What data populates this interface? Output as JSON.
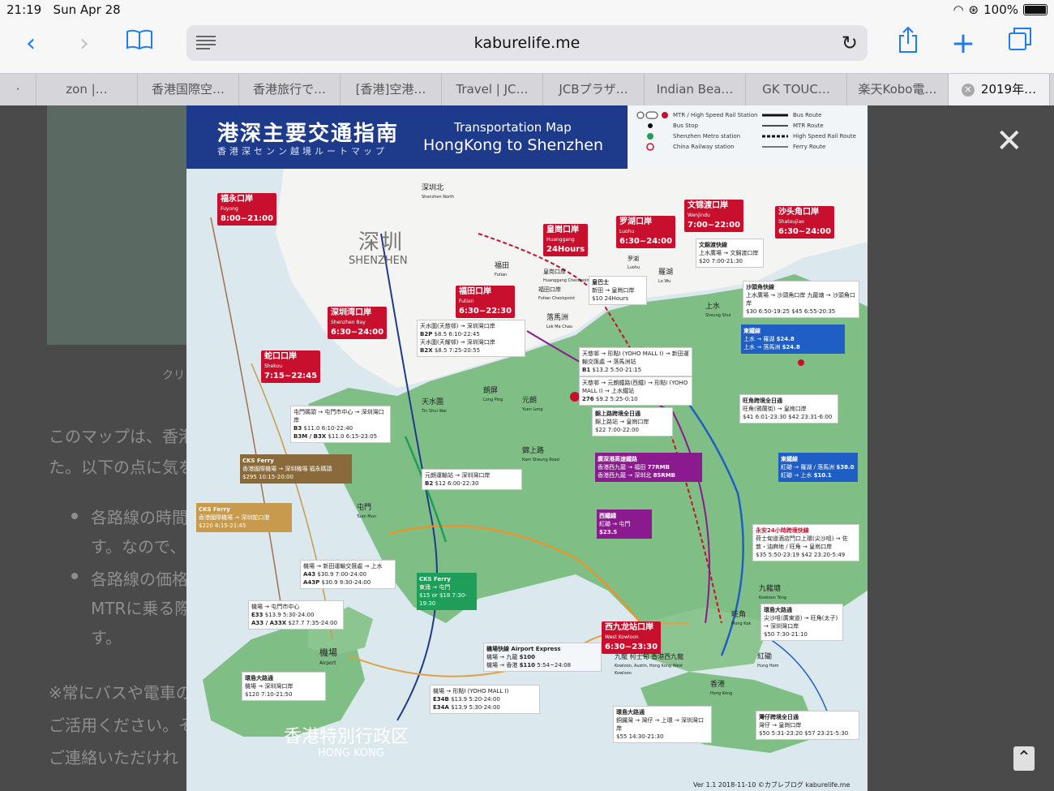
{
  "status_bar": {
    "time": "21:19",
    "date": "Sun Apr 28",
    "battery": "100%"
  },
  "toolbar": {
    "url": "kaburelife.me"
  },
  "tabs": [
    {
      "label": "·"
    },
    {
      "label": "zon |…"
    },
    {
      "label": "香港国際空…"
    },
    {
      "label": "香港旅行で…"
    },
    {
      "label": "[香港]空港…"
    },
    {
      "label": "Travel | JC…"
    },
    {
      "label": "JCBプラザ…"
    },
    {
      "label": "Indian Bea…"
    },
    {
      "label": "GK TOUC…"
    },
    {
      "label": "楽天Kobo電…"
    },
    {
      "label": "2019年…"
    }
  ],
  "background": {
    "caption": "クリ",
    "lines": [
      "このマップは、香港",
      "た。以下の点に気を",
      "各路線の時間",
      "す。なので、",
      "各路線の価格",
      "MTRに乗る際",
      "す。",
      "※常にバスや電車の",
      "ご活用ください。そ",
      "ご連絡いただけれ"
    ]
  },
  "map": {
    "title_jp": "港深主要交通指南",
    "subtitle_jp": "香港深センン越境ルートマップ",
    "title_en_1": "Transportation Map",
    "title_en_2": "HongKong to Shenzhen",
    "legend": [
      "MTR / High Speed Rail Station",
      "Bus Stop",
      "Shenzhen Metro station",
      "China Railway station",
      "Bus Route",
      "MTR Route",
      "High Speed Rail Route",
      "Ferry Route"
    ],
    "region_sz_cn": "深圳",
    "region_sz_en": "SHENZHEN",
    "region_hk_cn": "香港特別行政区",
    "region_hk_en": "HONG KONG",
    "ports": [
      {
        "name": "福永口岸",
        "en": "Fuyong",
        "hours": "8:00~21:00"
      },
      {
        "name": "皇崗口岸",
        "en": "Huanggang",
        "hours": "24Hours"
      },
      {
        "name": "罗湖口岸",
        "en": "Luohu",
        "hours": "6:30~24:00"
      },
      {
        "name": "文锦渡口岸",
        "en": "Wenjindu",
        "hours": "7:00~22:00"
      },
      {
        "name": "沙头角口岸",
        "en": "Shatoujiao",
        "hours": "6:30~24:00"
      },
      {
        "name": "福田口岸",
        "en": "Futian",
        "hours": "6:30~22:30"
      },
      {
        "name": "深圳湾口岸",
        "en": "Shenzhen Bay",
        "hours": "6:30~24:00"
      },
      {
        "name": "蛇口口岸",
        "en": "Shekou",
        "hours": "7:15~22:45"
      },
      {
        "name": "西九龙站口岸",
        "en": "West Kowloon",
        "hours": "6:30~23:30"
      }
    ],
    "stations": [
      {
        "name": "深圳北",
        "en": "Shenzhen North"
      },
      {
        "name": "福田",
        "en": "Futian"
      },
      {
        "name": "皇岗口岸",
        "en": "Huanggang Checkpoint"
      },
      {
        "name": "福田口岸",
        "en": "Futian Checkpoint"
      },
      {
        "name": "罗湖",
        "en": "Luohu"
      },
      {
        "name": "羅湖",
        "en": "Lo Wu"
      },
      {
        "name": "上水",
        "en": "Sheung Shui"
      },
      {
        "name": "落馬洲",
        "en": "Lok Ma Chau"
      },
      {
        "name": "天水圍",
        "en": "Tin Shui Wai"
      },
      {
        "name": "朗屏",
        "en": "Long Ping"
      },
      {
        "name": "元朗",
        "en": "Yuen Long"
      },
      {
        "name": "錦上路",
        "en": "Kam Sheung Road"
      },
      {
        "name": "屯門",
        "en": "Tuen Mun"
      },
      {
        "name": "機場",
        "en": "Airport"
      },
      {
        "name": "九龍塘",
        "en": "Kowloon Tong"
      },
      {
        "name": "旺角",
        "en": "Mong Kok"
      },
      {
        "name": "紅磡",
        "en": "Hung Hom"
      },
      {
        "name": "香港",
        "en": "Hong Kong"
      },
      {
        "name": "九龍 柯士甸 香港西九龍",
        "en": "Kowloon, Austin, Hong Kong West Kowloon"
      }
    ],
    "boxes": {
      "fuyong_bus": {
        "title": "皇巴士",
        "line": "新田 → 皇崗口岸",
        "price": "$10 24Hours"
      },
      "wenjindu_bus": {
        "title": "文錦渡快線",
        "line": "上水廣場 → 文錦渡口岸",
        "price": "$20 7:00-21:30"
      },
      "shatoujiao_bus": {
        "title": "沙頭角快線",
        "line1": "上水廣場 → 沙頭角口岸",
        "line2": "九龍塘 → 沙頭角口岸",
        "price1": "$30 6:50-19:25",
        "price2": "$45 6:55-20:35"
      },
      "east_rail_1": {
        "title": "東鐵線",
        "line1": "上水 → 羅湖",
        "line2": "上水 → 落馬洲",
        "price1": "$24.8",
        "price2": "$24.8"
      },
      "nwfb_b2p": {
        "line1": "天水圍(天慈邨) → 深圳灣口岸",
        "code1": "B2P",
        "price1": "$8.5 6:10-22:45",
        "line2": "天水圍(天耀邨) → 深圳灣口岸",
        "code2": "B2X",
        "price2": "$8.5 7:25-20:55"
      },
      "kmb_b1": {
        "line": "天慈邨 → 形點I (YOHO MALL I) → 新田運輸交匯處 → 落馬洲站",
        "code": "B1",
        "price": "$13.2 5:50-21:15"
      },
      "kmb_276": {
        "line": "天慈邨 → 元朗鐵路(西鐵) → 形點I (YOHO MALL I) → 上水鐵站",
        "code": "276",
        "price": "$9.2 5:25-0:10"
      },
      "kingbus": {
        "title": "錦上路跨境全日通",
        "line": "錦上路站 → 皇崗口岸",
        "price": "$22 7:00-22:00"
      },
      "xrl": {
        "title": "廣深港高速鐵路",
        "line1": "香港西九龍 → 福田",
        "price1": "77RMB",
        "line2": "香港西九龍 → 深圳北",
        "price2": "85RMB"
      },
      "west_rail": {
        "title": "西鐵綫",
        "line": "紅磡 → 屯門",
        "price": "$23.5"
      },
      "wanjiang": {
        "title": "旺角跨境全日通",
        "line": "旺角(鴉蘭街) → 皇崗口岸",
        "price": "$41 6:01-23:30 $42 23:31-6:00"
      },
      "east_rail_2": {
        "title": "東鐵線",
        "line1": "紅磡 → 羅湖 / 落馬洲",
        "price1": "$38.0",
        "line2": "紅磡 → 上水",
        "price2": "$10.1"
      },
      "yongan": {
        "title": "永安24小時跨境快線",
        "line": "荷士甸道酒店門口上環(尖沙咀) → 佐敦・油麻地 / 旺角 → 皇崗口岸",
        "price": "$35 5:50-23:19 $42 23:20-5:49"
      },
      "kowloon_tong": {
        "title": "環島大路通",
        "line": "尖沙咀(廣東道) → 旺角(太子) → 深圳灣口岸",
        "price": "$50 7:30-21:10"
      },
      "nwfb_b2": {
        "line": "元朗運輸站 → 深圳灣口岸",
        "code": "B2",
        "price": "$12 6:00-22:30"
      },
      "citybus_b3": {
        "line": "屯門碼頭 → 屯門市中心 → 深圳灣口岸",
        "code1": "B3",
        "price1": "$11.0 6:10-22:40",
        "code2": "B3M / B3X",
        "price2": "$11.0 6:15-23:05"
      },
      "cks_ferry_1": {
        "title": "CKS Ferry",
        "line": "香港國際機場 → 深圳機場 福永碼頭",
        "price": "$295 10:15-20:00"
      },
      "cks_ferry_2": {
        "title": "CKS Ferry",
        "line": "香港國際機場 → 深圳蛇口港",
        "price": "$220 8:15-21:45"
      },
      "cks_ferry_3": {
        "title": "CKS Ferry",
        "line": "東涌 → 屯門",
        "price": "$15 or $18 7:30-19:30"
      },
      "lwb_a43": {
        "line": "機場 → 新田運輸交匯處 → 上水",
        "code1": "A43",
        "price1": "$30.9 7:00-24:00",
        "code2": "A43P",
        "price2": "$30.9 9:30-24:00"
      },
      "kmb_e33": {
        "line": "機場 → 屯門市中心",
        "code1": "E33",
        "price1": "$13.9 5:30-24:00",
        "code2": "A33 / A33X",
        "price2": "$27.7 7:35-24:00"
      },
      "airport_express": {
        "title": "機場快線 Airport Express",
        "line1": "機場 → 九龍",
        "price1": "$100",
        "line2": "機場 → 香港",
        "price2": "$110",
        "hours": "5:54~24:08"
      },
      "lwb_e34b": {
        "line": "機場 → 形點I (YOHO MALL I)",
        "code1": "E34B",
        "price1": "$13.9 5:20-24:00",
        "code2": "E34A",
        "price2": "$13.9 5:30-24:00"
      },
      "airport_bus": {
        "title": "環島大路通",
        "line": "機場 → 深圳灣口岸",
        "price": "$120 7:10-21:50"
      },
      "wanchai_bus": {
        "title": "環島大路通",
        "line": "銅鑼灣 → 灣仔 → 上環 → 深圳灣口岸",
        "price": "$55 14:30-21:30"
      },
      "wanchai_allday": {
        "title": "灣仔跨境全日通",
        "line": "灣仔 → 皇崗口岸",
        "price": "$50 5:31-23:20 $57 23:21-5:30"
      }
    },
    "footer": "Ver 1.1  2018-11-10  ©カブレブログ kaburelife.me"
  }
}
